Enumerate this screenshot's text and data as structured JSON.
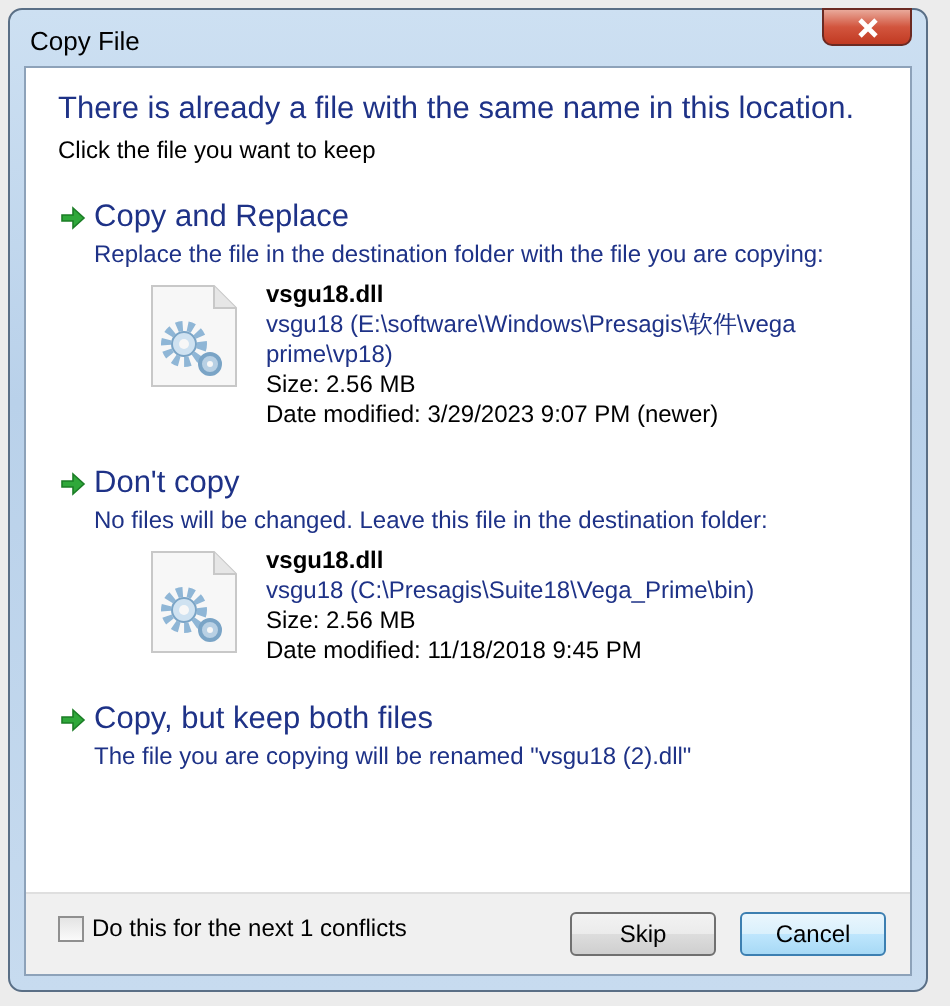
{
  "window": {
    "title": "Copy File"
  },
  "heading": "There is already a file with the same name in this location.",
  "instruction": "Click the file you want to keep",
  "options": [
    {
      "title": "Copy and Replace",
      "description": "Replace the file in the destination folder with the file you are copying:",
      "file": {
        "name": "vsgu18.dll",
        "path": "vsgu18 (E:\\software\\Windows\\Presagis\\软件\\vega prime\\vp18)",
        "size": "Size: 2.56 MB",
        "modified": "Date modified: 3/29/2023 9:07 PM (newer)"
      }
    },
    {
      "title": "Don't copy",
      "description": "No files will be changed. Leave this file in the destination folder:",
      "file": {
        "name": "vsgu18.dll",
        "path": "vsgu18 (C:\\Presagis\\Suite18\\Vega_Prime\\bin)",
        "size": "Size: 2.56 MB",
        "modified": "Date modified: 11/18/2018 9:45 PM"
      }
    },
    {
      "title": "Copy, but keep both files",
      "description": "The file you are copying will be renamed \"vsgu18 (2).dll\""
    }
  ],
  "footer": {
    "checkbox": {
      "label": "Do this for the next 1 conflicts",
      "checked": false
    },
    "buttons": [
      {
        "label": "Skip",
        "default": false
      },
      {
        "label": "Cancel",
        "default": true
      }
    ]
  }
}
